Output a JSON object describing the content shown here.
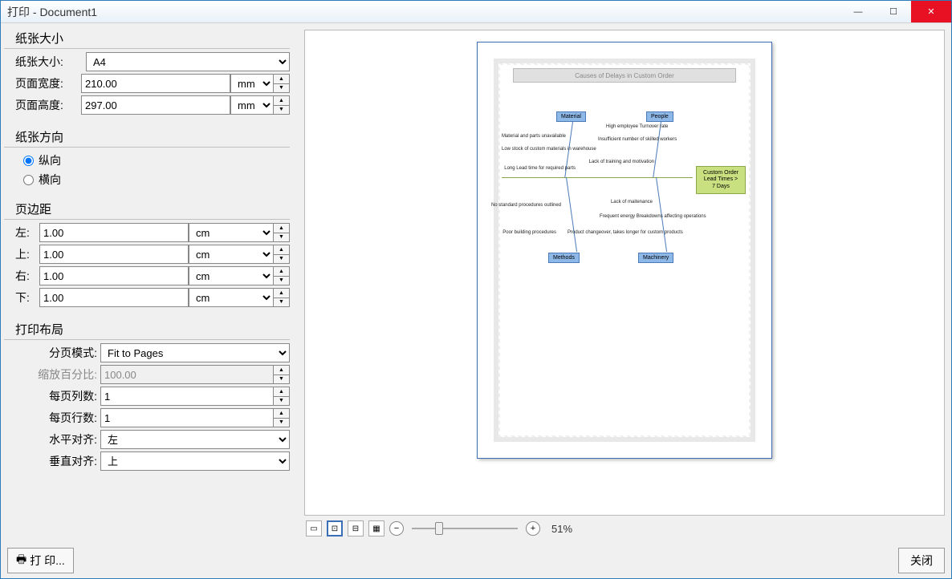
{
  "title": "打印 - Document1",
  "paper_size": {
    "group_title": "纸张大小",
    "size_label": "纸张大小:",
    "size_value": "A4",
    "width_label": "页面宽度:",
    "width_value": "210.00",
    "width_unit": "mm",
    "height_label": "页面高度:",
    "height_value": "297.00",
    "height_unit": "mm"
  },
  "orientation": {
    "group_title": "纸张方向",
    "portrait": "纵向",
    "landscape": "横向"
  },
  "margins": {
    "group_title": "页边距",
    "left_label": "左:",
    "left_value": "1.00",
    "top_label": "上:",
    "top_value": "1.00",
    "right_label": "右:",
    "right_value": "1.00",
    "bottom_label": "下:",
    "bottom_value": "1.00",
    "unit": "cm"
  },
  "layout": {
    "group_title": "打印布局",
    "paging_label": "分页模式:",
    "paging_value": "Fit to Pages",
    "scale_label": "缩放百分比:",
    "scale_value": "100.00",
    "cols_label": "每页列数:",
    "cols_value": "1",
    "rows_label": "每页行数:",
    "rows_value": "1",
    "halign_label": "水平对齐:",
    "halign_value": "左",
    "valign_label": "垂直对齐:",
    "valign_value": "上"
  },
  "buttons": {
    "print": "打 印...",
    "close": "关闭"
  },
  "zoom": {
    "percent": "51%"
  },
  "diagram": {
    "title": "Causes of Delays in Custom Order",
    "categories": {
      "material": "Material",
      "people": "People",
      "methods": "Methods",
      "machinery": "Machinery"
    },
    "result": "Custom Order Lead Times > 7 Days",
    "causes": {
      "mat1": "Material and parts unavailable",
      "mat2": "Low stock of custom materials in warehouse",
      "mat3": "Long Lead time for required parts",
      "ppl1": "High employee Turnover rate",
      "ppl2": "Insufficient number of skilled workers",
      "ppl3": "Lack of training and motivation",
      "mth1": "No standard procedures outlined",
      "mth2": "Poor building procedures",
      "mch1": "Lack of maitenance",
      "mch2": "Frequent energy Breakdowns affecting operations",
      "mch3": "Product changeover, takes longer for custom products"
    }
  }
}
